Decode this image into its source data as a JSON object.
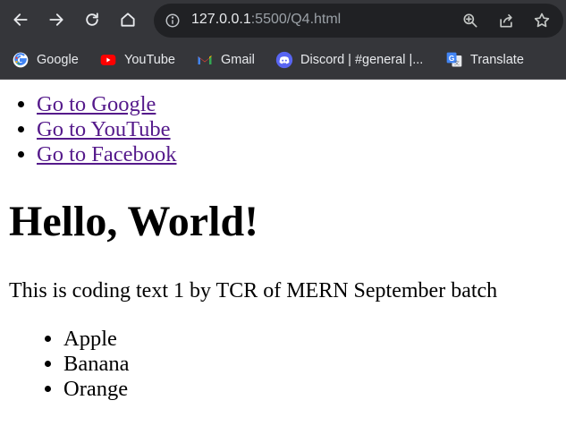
{
  "browser": {
    "url_host": "127.0.0.1",
    "url_rest": ":5500/Q4.html",
    "bookmarks": [
      {
        "label": "Google",
        "icon": "google-icon"
      },
      {
        "label": "YouTube",
        "icon": "youtube-icon"
      },
      {
        "label": "Gmail",
        "icon": "gmail-icon"
      },
      {
        "label": "Discord | #general |...",
        "icon": "discord-icon"
      },
      {
        "label": "Translate",
        "icon": "translate-icon"
      }
    ]
  },
  "page": {
    "links": [
      "Go to Google",
      "Go to YouTube",
      "Go to Facebook"
    ],
    "heading": "Hello, World!",
    "paragraph": "This is coding text 1 by TCR of MERN September batch",
    "fruits": [
      "Apple",
      "Banana",
      "Orange"
    ]
  },
  "colors": {
    "chrome_bg": "#35363a",
    "omnibox_bg": "#202124",
    "visited_link": "#551a8b"
  }
}
